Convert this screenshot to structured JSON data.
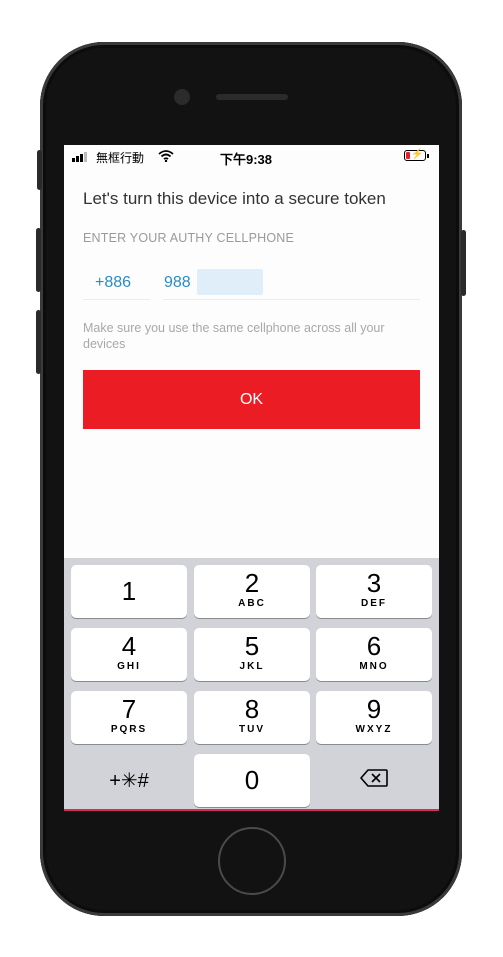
{
  "status_bar": {
    "carrier": "無框行動",
    "time": "下午9:38",
    "icons": [
      "signal-icon",
      "wifi-icon",
      "battery-charging-icon"
    ]
  },
  "screen": {
    "heading": "Let's turn this device into a secure token",
    "phone_label": "ENTER YOUR AUTHY CELLPHONE",
    "country_code": "+886",
    "phone_number": "988",
    "hint": "Make sure you use the same cellphone across all your devices",
    "ok_label": "OK",
    "accent": "#2b8cc4",
    "button_color": "#ec1c24"
  },
  "keypad": {
    "keys": [
      {
        "digit": "1",
        "letters": ""
      },
      {
        "digit": "2",
        "letters": "ABC"
      },
      {
        "digit": "3",
        "letters": "DEF"
      },
      {
        "digit": "4",
        "letters": "GHI"
      },
      {
        "digit": "5",
        "letters": "JKL"
      },
      {
        "digit": "6",
        "letters": "MNO"
      },
      {
        "digit": "7",
        "letters": "PQRS"
      },
      {
        "digit": "8",
        "letters": "TUV"
      },
      {
        "digit": "9",
        "letters": "WXYZ"
      },
      {
        "digit": "0",
        "letters": ""
      }
    ],
    "symbols_label": "+✳#",
    "delete_icon": "backspace-icon"
  }
}
